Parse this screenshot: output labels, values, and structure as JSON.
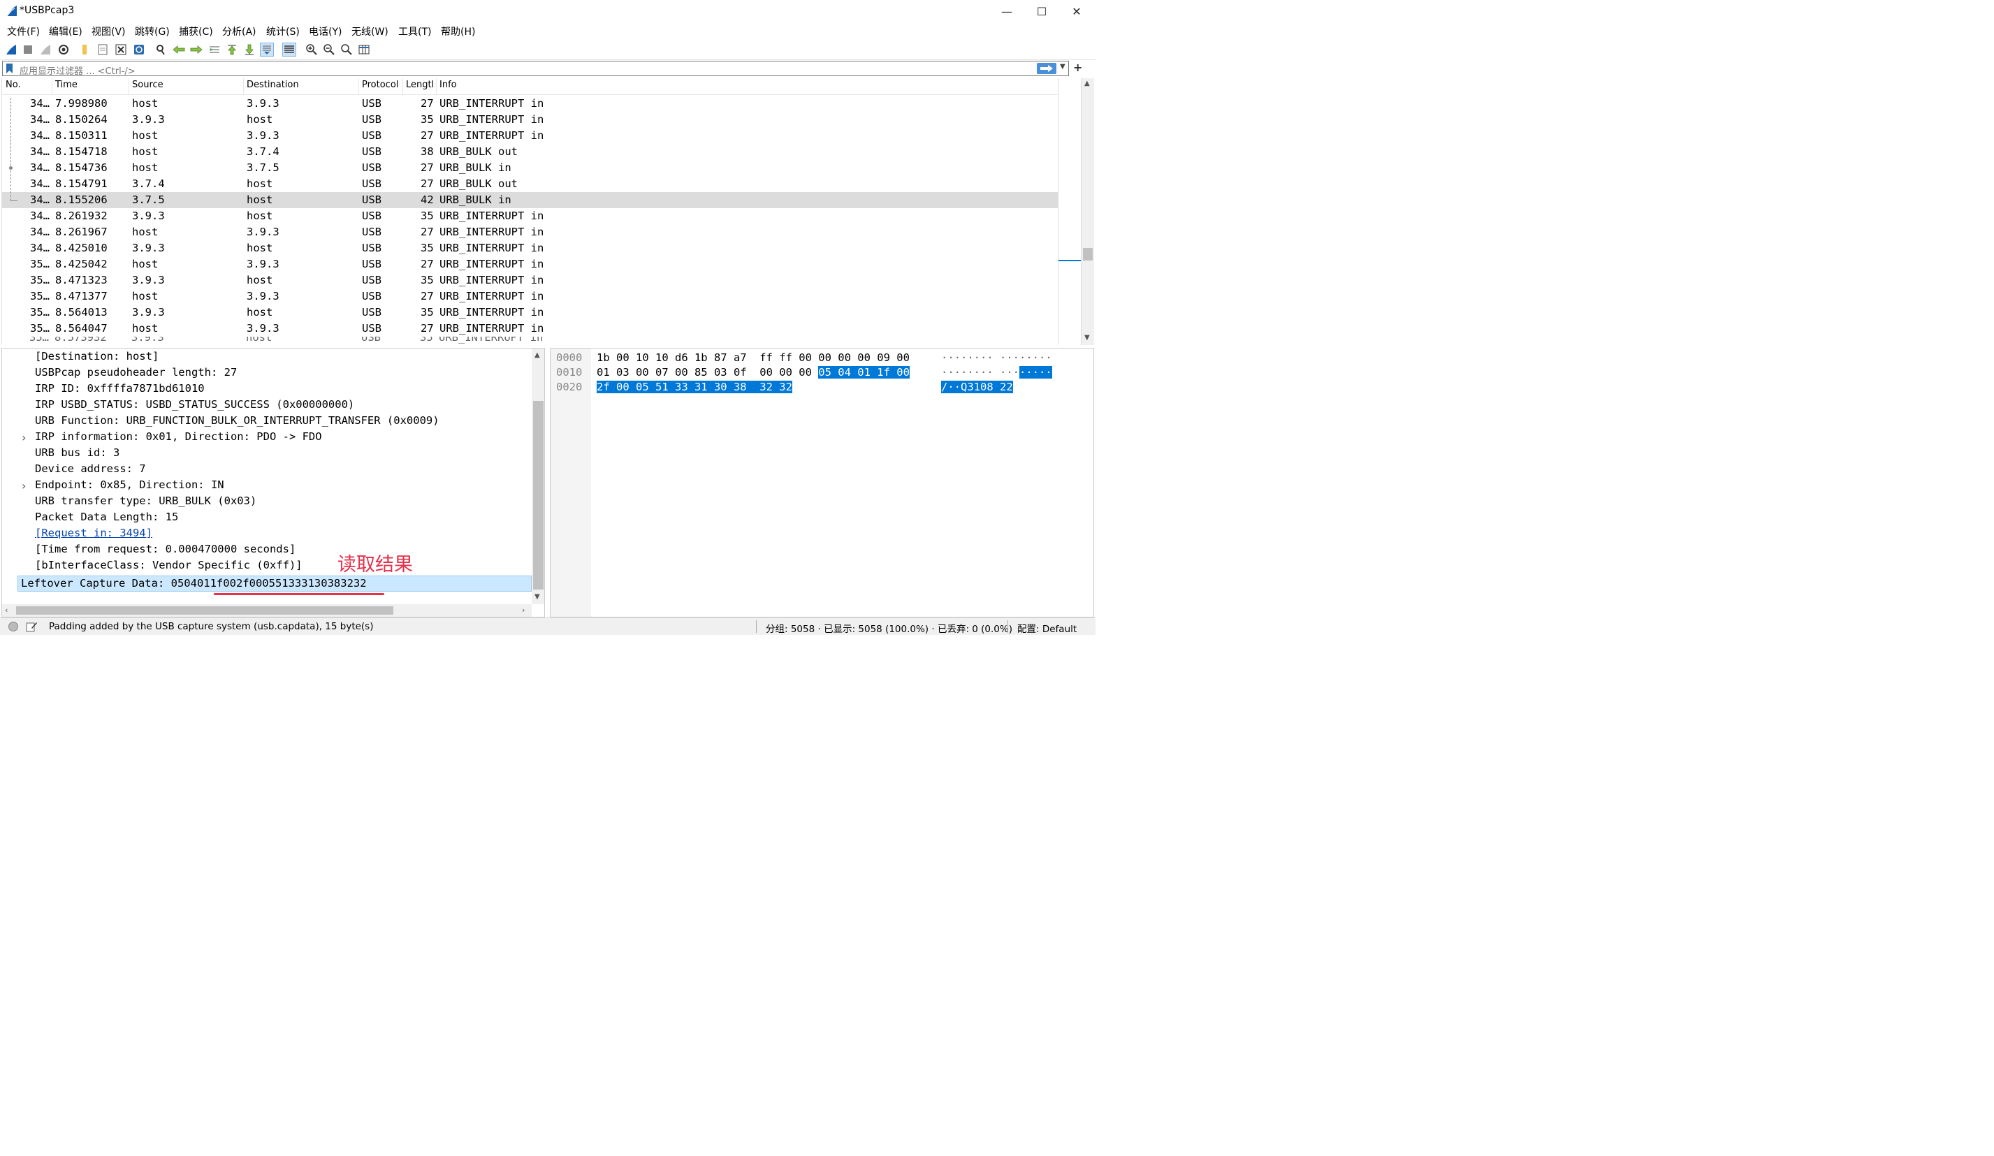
{
  "window": {
    "title": "*USBPcap3",
    "minimize": "—",
    "maximize": "☐",
    "close": "✕"
  },
  "menu": [
    "文件(F)",
    "编辑(E)",
    "视图(V)",
    "跳转(G)",
    "捕获(C)",
    "分析(A)",
    "统计(S)",
    "电话(Y)",
    "无线(W)",
    "工具(T)",
    "帮助(H)"
  ],
  "filter": {
    "placeholder": "应用显示过滤器 ... <Ctrl-/>",
    "plus": "+"
  },
  "packet_list": {
    "columns": [
      "No.",
      "Time",
      "Source",
      "Destination",
      "Protocol",
      "Lengtl",
      "Info"
    ],
    "rows": [
      {
        "no": "34…",
        "time": "7.998980",
        "src": "host",
        "dst": "3.9.3",
        "proto": "USB",
        "len": "27",
        "info": "URB_INTERRUPT in"
      },
      {
        "no": "34…",
        "time": "8.150264",
        "src": "3.9.3",
        "dst": "host",
        "proto": "USB",
        "len": "35",
        "info": "URB_INTERRUPT in"
      },
      {
        "no": "34…",
        "time": "8.150311",
        "src": "host",
        "dst": "3.9.3",
        "proto": "USB",
        "len": "27",
        "info": "URB_INTERRUPT in"
      },
      {
        "no": "34…",
        "time": "8.154718",
        "src": "host",
        "dst": "3.7.4",
        "proto": "USB",
        "len": "38",
        "info": "URB_BULK out"
      },
      {
        "no": "34…",
        "time": "8.154736",
        "src": "host",
        "dst": "3.7.5",
        "proto": "USB",
        "len": "27",
        "info": "URB_BULK in"
      },
      {
        "no": "34…",
        "time": "8.154791",
        "src": "3.7.4",
        "dst": "host",
        "proto": "USB",
        "len": "27",
        "info": "URB_BULK out"
      },
      {
        "no": "34…",
        "time": "8.155206",
        "src": "3.7.5",
        "dst": "host",
        "proto": "USB",
        "len": "42",
        "info": "URB_BULK in"
      },
      {
        "no": "34…",
        "time": "8.261932",
        "src": "3.9.3",
        "dst": "host",
        "proto": "USB",
        "len": "35",
        "info": "URB_INTERRUPT in"
      },
      {
        "no": "34…",
        "time": "8.261967",
        "src": "host",
        "dst": "3.9.3",
        "proto": "USB",
        "len": "27",
        "info": "URB_INTERRUPT in"
      },
      {
        "no": "34…",
        "time": "8.425010",
        "src": "3.9.3",
        "dst": "host",
        "proto": "USB",
        "len": "35",
        "info": "URB_INTERRUPT in"
      },
      {
        "no": "35…",
        "time": "8.425042",
        "src": "host",
        "dst": "3.9.3",
        "proto": "USB",
        "len": "27",
        "info": "URB_INTERRUPT in"
      },
      {
        "no": "35…",
        "time": "8.471323",
        "src": "3.9.3",
        "dst": "host",
        "proto": "USB",
        "len": "35",
        "info": "URB_INTERRUPT in"
      },
      {
        "no": "35…",
        "time": "8.471377",
        "src": "host",
        "dst": "3.9.3",
        "proto": "USB",
        "len": "27",
        "info": "URB_INTERRUPT in"
      },
      {
        "no": "35…",
        "time": "8.564013",
        "src": "3.9.3",
        "dst": "host",
        "proto": "USB",
        "len": "35",
        "info": "URB_INTERRUPT in"
      },
      {
        "no": "35…",
        "time": "8.564047",
        "src": "host",
        "dst": "3.9.3",
        "proto": "USB",
        "len": "27",
        "info": "URB_INTERRUPT in"
      }
    ],
    "selected_index": 6
  },
  "details": [
    {
      "text": "[Destination: host]",
      "expander": ""
    },
    {
      "text": "USBPcap pseudoheader length: 27",
      "expander": ""
    },
    {
      "text": "IRP ID: 0xffffa7871bd61010",
      "expander": ""
    },
    {
      "text": "IRP USBD_STATUS: USBD_STATUS_SUCCESS (0x00000000)",
      "expander": ""
    },
    {
      "text": "URB Function: URB_FUNCTION_BULK_OR_INTERRUPT_TRANSFER (0x0009)",
      "expander": ""
    },
    {
      "text": "IRP information: 0x01, Direction: PDO -> FDO",
      "expander": "›"
    },
    {
      "text": "URB bus id: 3",
      "expander": ""
    },
    {
      "text": "Device address: 7",
      "expander": ""
    },
    {
      "text": "Endpoint: 0x85, Direction: IN",
      "expander": "›"
    },
    {
      "text": "URB transfer type: URB_BULK (0x03)",
      "expander": ""
    },
    {
      "text": "Packet Data Length: 15",
      "expander": ""
    },
    {
      "text": "[Request in: 3494]",
      "expander": "",
      "link": true
    },
    {
      "text": "[Time from request: 0.000470000 seconds]",
      "expander": ""
    },
    {
      "text": "[bInterfaceClass: Vendor Specific (0xff)]",
      "expander": ""
    }
  ],
  "leftover": "Leftover Capture Data: 0504011f002f000551333130383232",
  "annotation": "读取结果",
  "bytes": {
    "offsets": [
      "0000",
      "0010",
      "0020"
    ],
    "hex_plain": [
      "1b 00 10 10 d6 1b 87 a7  ff ff 00 00 00 00 09 00",
      "01 03 00 07 00 85 03 0f  00 00 00",
      ""
    ],
    "hex_hl": [
      "",
      "05 04 01 1f 00",
      "2f 00 05 51 33 31 30 38  32 32"
    ],
    "ascii_plain": [
      "········ ········",
      "········ ···",
      ""
    ],
    "ascii_hl": [
      "",
      "·····",
      "/··Q3108 22"
    ]
  },
  "status": {
    "message": "Padding added by the USB capture system (usb.capdata), 15 byte(s)",
    "counts": "分组: 5058 · 已显示: 5058 (100.0%) · 已丢弃: 0 (0.0%)",
    "profile": "配置: Default"
  },
  "colors": {
    "selection": "#0078d7",
    "row_selected": "#dcdcdc",
    "detail_selected": "#cce8ff",
    "annotation": "#e8304a"
  }
}
